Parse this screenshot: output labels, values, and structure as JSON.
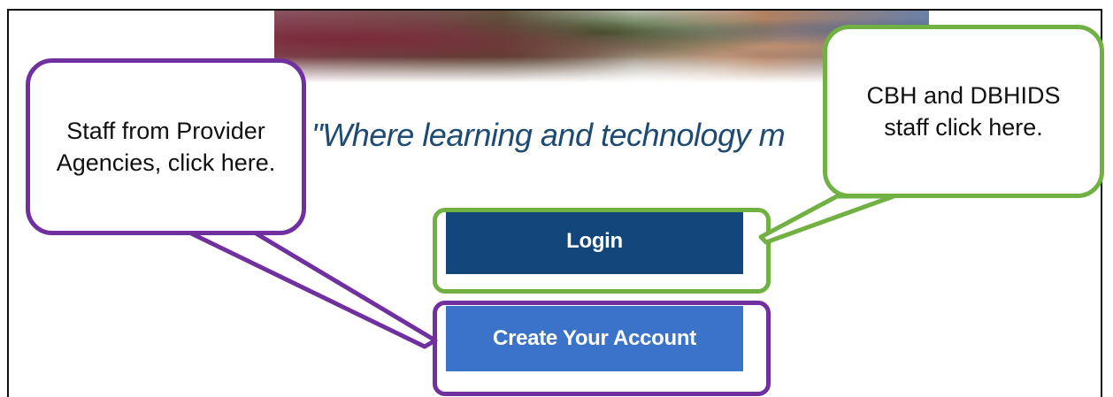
{
  "tagline": "\"Where learning and technology m",
  "buttons": {
    "login_label": "Login",
    "create_account_label": "Create Your Account"
  },
  "callouts": {
    "provider_staff": [
      "Staff from Provider",
      "Agencies, click here."
    ],
    "cbh_staff": [
      "CBH and DBHIDS",
      "staff click here."
    ]
  },
  "colors": {
    "login_bg": "#12467a",
    "create_bg": "#3b73c8",
    "green_highlight": "#71b043",
    "purple_highlight": "#7030a0",
    "tagline": "#1f4a72"
  }
}
